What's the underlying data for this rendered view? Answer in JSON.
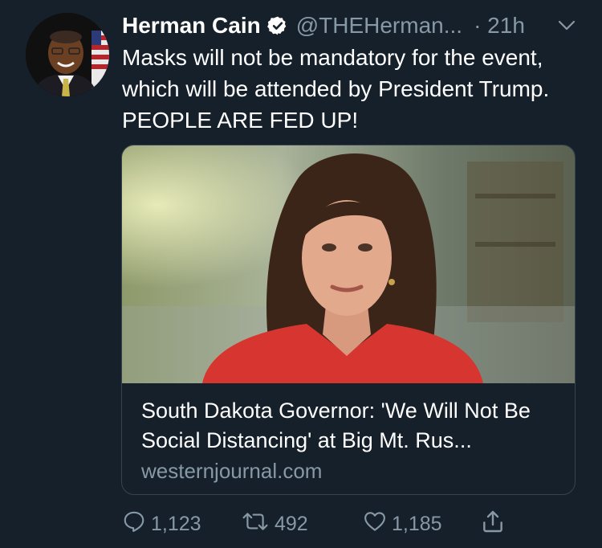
{
  "tweet": {
    "author_name": "Herman Cain",
    "handle": "@THEHerman...",
    "time": "· 21h",
    "text": "Masks will not be mandatory for the event, which will be attended by President Trump.  PEOPLE ARE FED UP!"
  },
  "card": {
    "title": "South Dakota Governor: 'We Will Not Be Social Distancing' at Big Mt. Rus...",
    "domain": "westernjournal.com"
  },
  "actions": {
    "reply_count": "1,123",
    "retweet_count": "492",
    "like_count": "1,185"
  },
  "icons": [
    "verified-badge-icon",
    "chevron-down-icon",
    "reply-icon",
    "retweet-icon",
    "like-icon",
    "share-icon"
  ],
  "colors": {
    "background": "#15202b",
    "secondary_text": "#8899a6",
    "card_border": "#38444d"
  }
}
